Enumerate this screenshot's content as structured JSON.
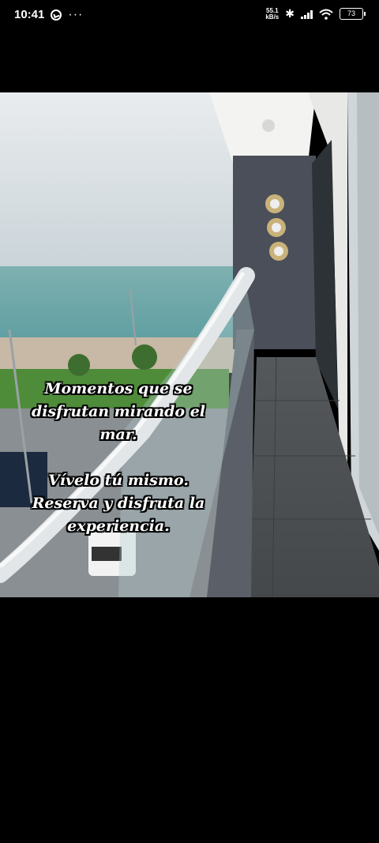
{
  "status_bar": {
    "time": "10:41",
    "more": "···",
    "net_speed_value": "55.1",
    "net_speed_unit": "kB/s",
    "battery": "73"
  },
  "photo": {
    "caption_lines_1": [
      "Momentos que se",
      "disfrutan mirando el",
      "mar."
    ],
    "caption_lines_2": [
      "Vívelo tú mismo.",
      "Reserva y disfruta la",
      "experiencia."
    ]
  }
}
